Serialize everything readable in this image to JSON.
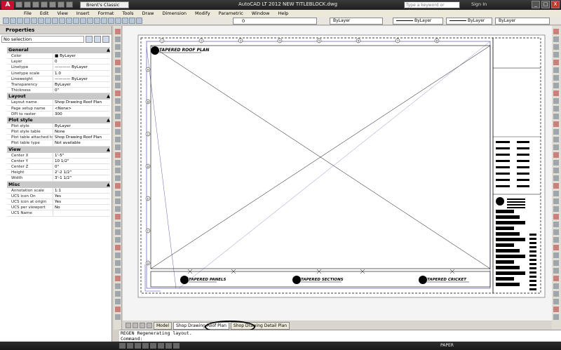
{
  "titlebar": {
    "app_logo": "A",
    "workspace": "Brent's Classic",
    "title": "AutoCAD LT 2012    NEW TITLEBLOCK.dwg",
    "search_placeholder": "Type a keyword or phrase",
    "signin": "Sign In",
    "window_buttons": [
      "_",
      "□",
      "X"
    ]
  },
  "menu": [
    "File",
    "Edit",
    "View",
    "Insert",
    "Format",
    "Tools",
    "Draw",
    "Dimension",
    "Modify",
    "Parametric",
    "Window",
    "Help"
  ],
  "toolbar": {
    "layer_value": "0",
    "color_value": "ByLayer",
    "linetype_value": "ByLayer",
    "lineweight_value": "ByLayer",
    "plotstyle_value": "ByLayer"
  },
  "properties": {
    "title": "Properties",
    "selection": "No selection",
    "groups": [
      {
        "name": "General",
        "rows": [
          [
            "Color",
            "■ ByLayer"
          ],
          [
            "Layer",
            "0"
          ],
          [
            "Linetype",
            "———— ByLayer"
          ],
          [
            "Linetype scale",
            "1.0"
          ],
          [
            "Lineweight",
            "———— ByLayer"
          ],
          [
            "Transparency",
            "ByLayer"
          ],
          [
            "Thickness",
            "0\""
          ]
        ]
      },
      {
        "name": "Layout",
        "rows": [
          [
            "Layout name",
            "Shop Drawing Roof Plan"
          ],
          [
            "Page setup name",
            "<None>"
          ],
          [
            "DPI to raster",
            "300"
          ]
        ]
      },
      {
        "name": "Plot style",
        "rows": [
          [
            "Plot style",
            "ByLayer"
          ],
          [
            "Plot style table",
            "None"
          ],
          [
            "Plot table attached to",
            "Shop Drawing Roof Plan"
          ],
          [
            "Plot table type",
            "Not available"
          ]
        ]
      },
      {
        "name": "View",
        "rows": [
          [
            "Center X",
            "1'-5\""
          ],
          [
            "Center Y",
            "10 1/2\""
          ],
          [
            "Center Z",
            "0\""
          ],
          [
            "Height",
            "2'-2 1/2\""
          ],
          [
            "Width",
            "3'-1 1/2\""
          ]
        ]
      },
      {
        "name": "Misc",
        "rows": [
          [
            "Annotation scale",
            "1:1"
          ],
          [
            "UCS icon On",
            "Yes"
          ],
          [
            "UCS icon at origin",
            "Yes"
          ],
          [
            "UCS per viewport",
            "No"
          ],
          [
            "UCS Name",
            ""
          ]
        ]
      }
    ]
  },
  "drawing": {
    "main_title": "TAPERED ROOF PLAN",
    "detail_titles": [
      "TAPERED PANELS",
      "TAPERED SECTIONS",
      "TAPERED CRICKET"
    ],
    "column_markers": [
      "1",
      "2",
      "3",
      "4",
      "5",
      "6",
      "7",
      "8"
    ],
    "row_markers": [
      "A",
      "B",
      "C",
      "D",
      "E",
      "F",
      "G"
    ]
  },
  "tabs": [
    "Model",
    "Shop Drawing Roof Plan",
    "Shop Drawing Detail Plan"
  ],
  "command": {
    "history": "REGEN Regenerating layout.",
    "prompt": "Command:"
  },
  "status": {
    "paper": "PAPER"
  }
}
